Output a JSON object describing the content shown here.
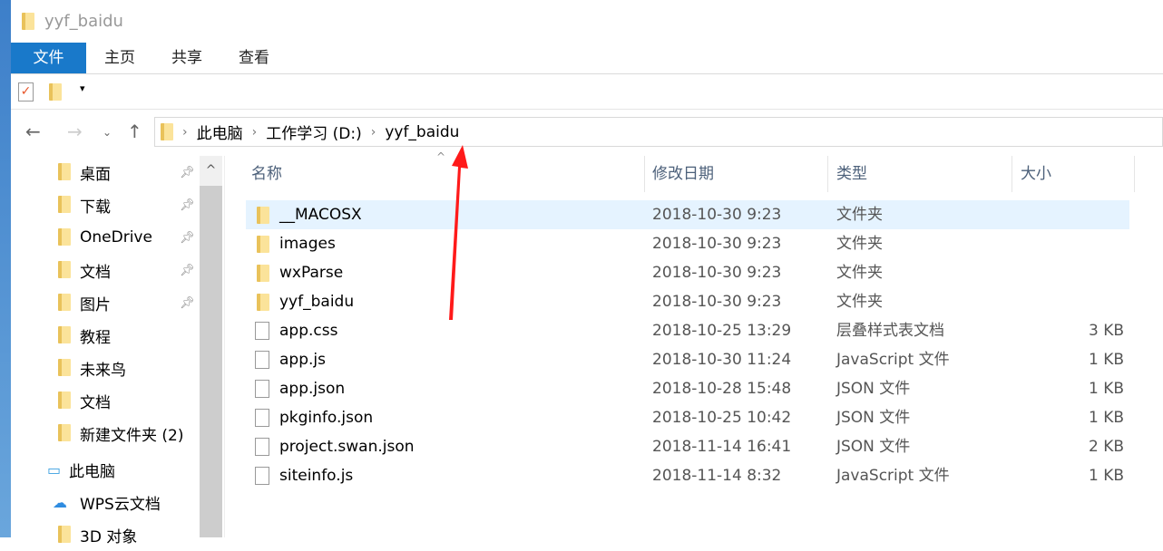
{
  "title": "yyf_baidu",
  "tabs": [
    "文件",
    "主页",
    "共享",
    "查看"
  ],
  "address": {
    "crumbs": [
      "此电脑",
      "工作学习 (D:)",
      "yyf_baidu"
    ]
  },
  "sidebar": [
    {
      "label": "桌面",
      "pinned": true
    },
    {
      "label": "下载",
      "pinned": true
    },
    {
      "label": "OneDrive",
      "pinned": true
    },
    {
      "label": "文档",
      "pinned": true
    },
    {
      "label": "图片",
      "pinned": true
    },
    {
      "label": "教程"
    },
    {
      "label": "未来鸟"
    },
    {
      "label": "文档"
    },
    {
      "label": "新建文件夹 (2)"
    },
    {
      "label": "此电脑"
    },
    {
      "label": "WPS云文档"
    },
    {
      "label": "3D 对象"
    }
  ],
  "columns": [
    "名称",
    "修改日期",
    "类型",
    "大小"
  ],
  "files": [
    {
      "name": "__MACOSX",
      "date": "2018-10-30 9:23",
      "type": "文件夹",
      "size": "",
      "folder": true
    },
    {
      "name": "images",
      "date": "2018-10-30 9:23",
      "type": "文件夹",
      "size": "",
      "folder": true
    },
    {
      "name": "wxParse",
      "date": "2018-10-30 9:23",
      "type": "文件夹",
      "size": "",
      "folder": true
    },
    {
      "name": "yyf_baidu",
      "date": "2018-10-30 9:23",
      "type": "文件夹",
      "size": "",
      "folder": true
    },
    {
      "name": "app.css",
      "date": "2018-10-25 13:29",
      "type": "层叠样式表文档",
      "size": "3 KB"
    },
    {
      "name": "app.js",
      "date": "2018-10-30 11:24",
      "type": "JavaScript 文件",
      "size": "1 KB"
    },
    {
      "name": "app.json",
      "date": "2018-10-28 15:48",
      "type": "JSON 文件",
      "size": "1 KB"
    },
    {
      "name": "pkginfo.json",
      "date": "2018-10-25 10:42",
      "type": "JSON 文件",
      "size": "1 KB"
    },
    {
      "name": "project.swan.json",
      "date": "2018-11-14 16:41",
      "type": "JSON 文件",
      "size": "2 KB"
    },
    {
      "name": "siteinfo.js",
      "date": "2018-11-14 8:32",
      "type": "JavaScript 文件",
      "size": "1 KB"
    }
  ],
  "colors": {
    "accent": "#1979ca",
    "selection": "#e5f3ff",
    "annotation": "#ff1a1a"
  }
}
